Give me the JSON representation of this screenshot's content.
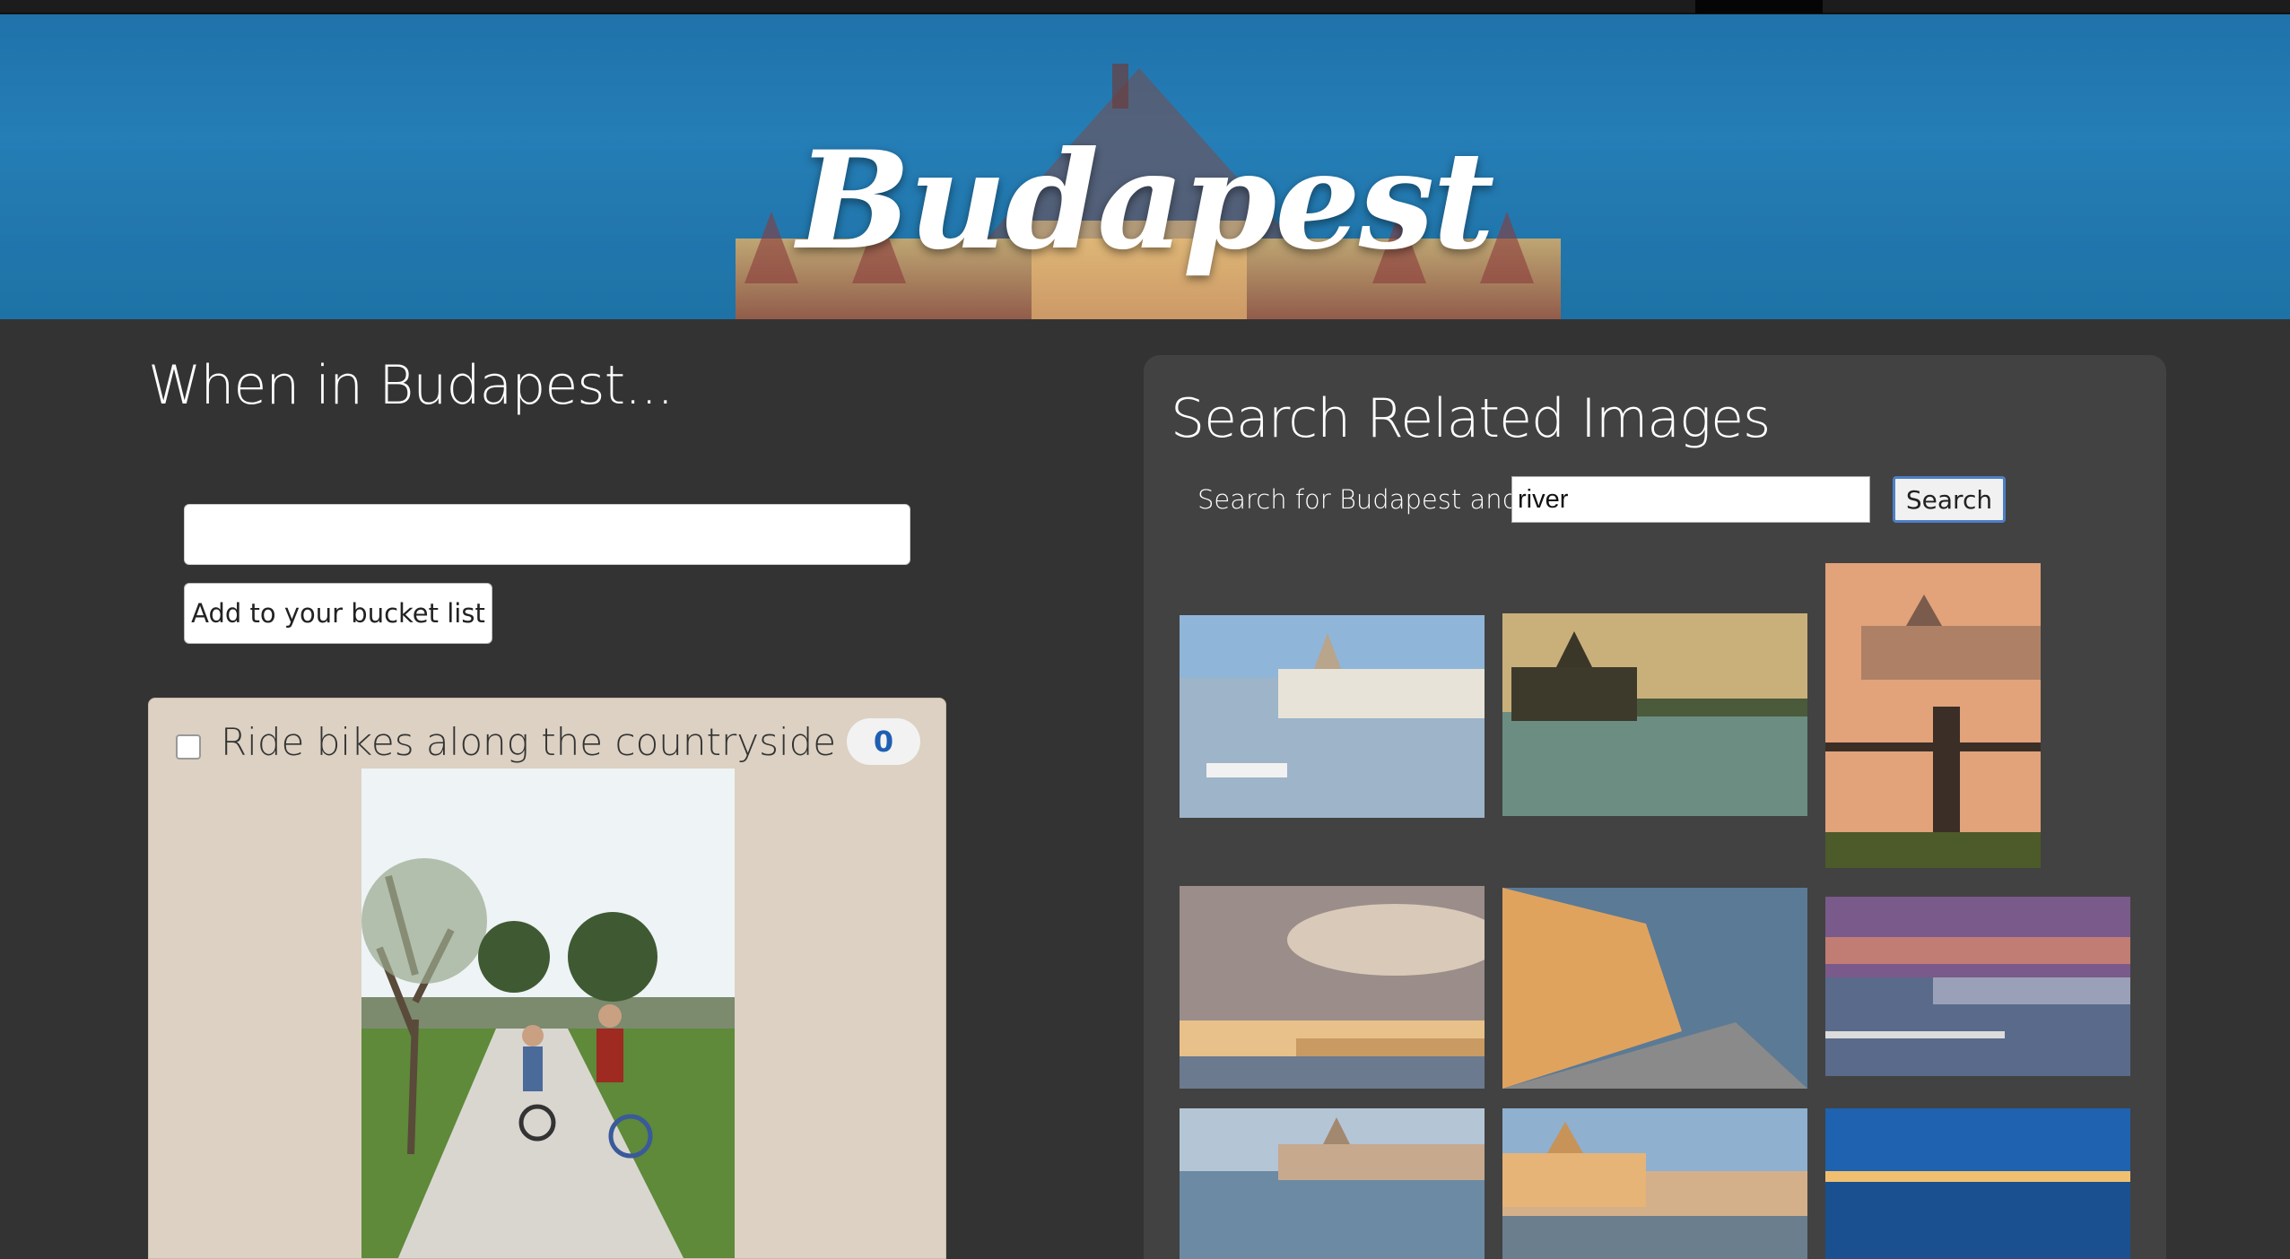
{
  "hero": {
    "title": "Budapest"
  },
  "bucket": {
    "heading": "When in Budapest...",
    "input_value": "",
    "add_button_label": "Add to your bucket list",
    "items": [
      {
        "label": "Ride bikes along the countryside",
        "count": "0",
        "checked": false
      }
    ]
  },
  "images": {
    "heading": "Search Related Images",
    "search_label": "Search for Budapest and...",
    "search_value": "river",
    "search_button_label": "Search"
  },
  "colors": {
    "page_bg": "#333333",
    "panel_bg": "#424242",
    "card_bg": "#dcd1c2",
    "badge_text": "#1e5fb3",
    "hero_sky": "#2781b9"
  }
}
